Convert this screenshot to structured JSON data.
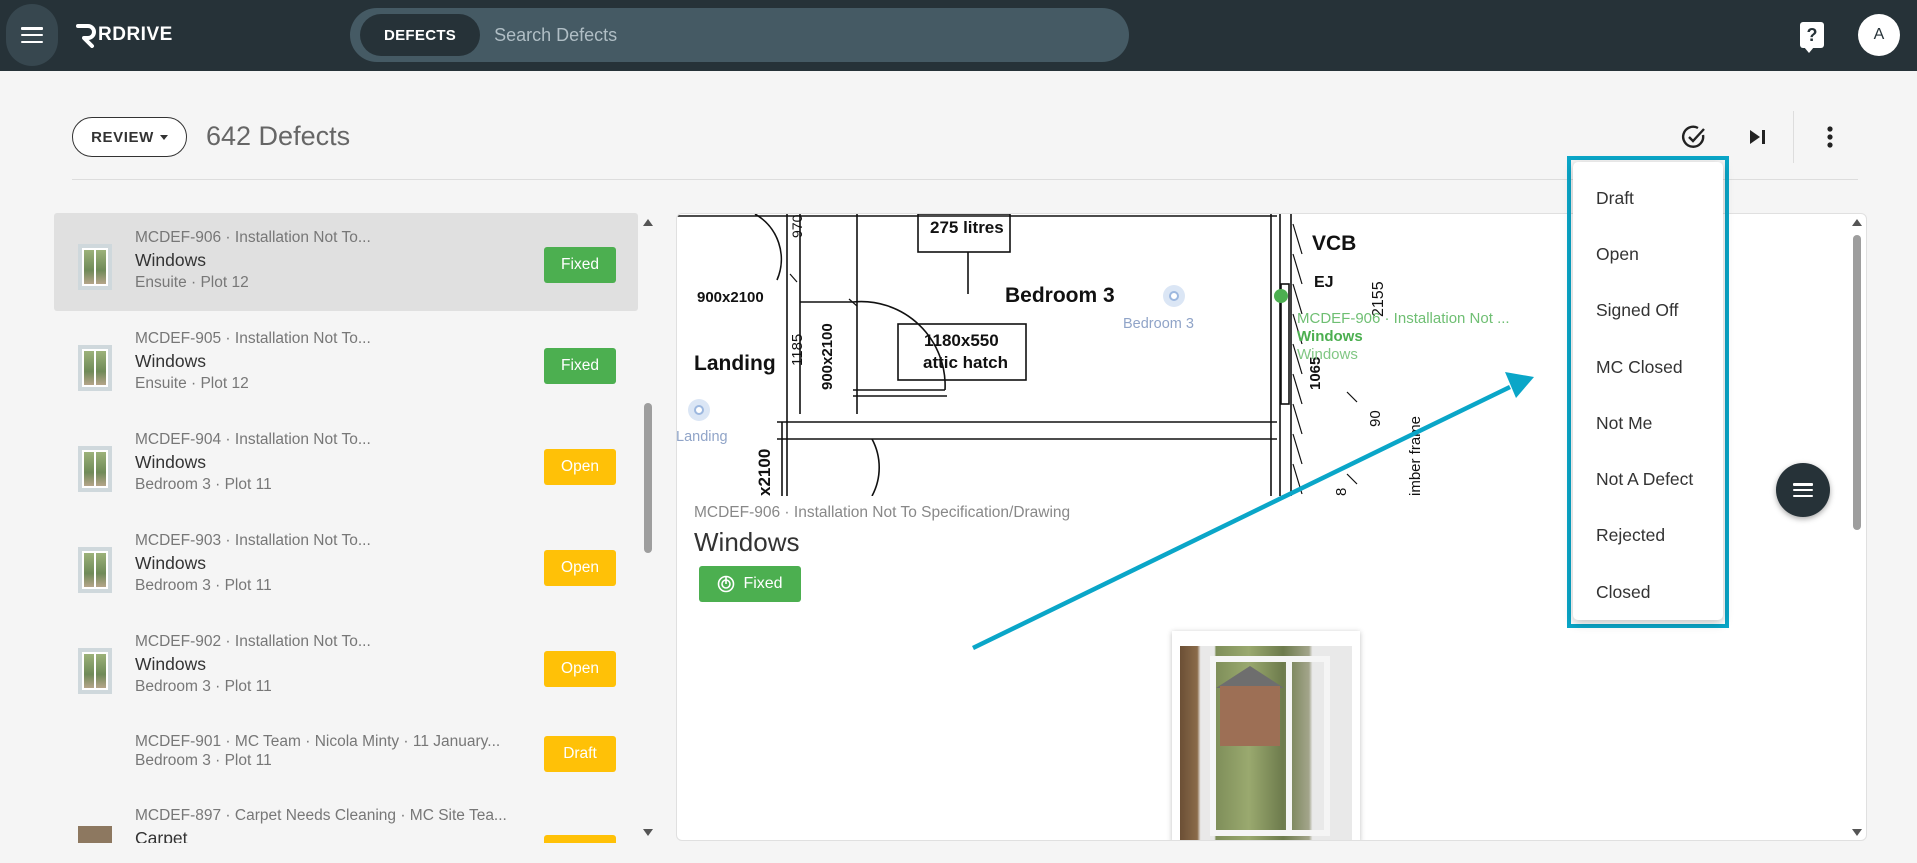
{
  "app": {
    "logo_text": "RDRIVE",
    "search_chip": "DEFECTS",
    "search_placeholder": "Search Defects",
    "help_glyph": "?",
    "avatar_initial": "A"
  },
  "header": {
    "review_label": "REVIEW",
    "defect_count": "642 Defects",
    "icons": [
      "check-circle-icon",
      "skip-next-icon",
      "more-vert-icon"
    ]
  },
  "list": {
    "items": [
      {
        "code": "MCDEF-906 · Installation Not To...",
        "title": "Windows",
        "location": "Ensuite · Plot 12",
        "status": "Fixed",
        "status_color": "#4caf50",
        "selected": true
      },
      {
        "code": "MCDEF-905 · Installation Not To...",
        "title": "Windows",
        "location": "Ensuite · Plot 12",
        "status": "Fixed",
        "status_color": "#4caf50"
      },
      {
        "code": "MCDEF-904 · Installation Not To...",
        "title": "Windows",
        "location": "Bedroom 3 · Plot 11",
        "status": "Open",
        "status_color": "#ffc107"
      },
      {
        "code": "MCDEF-903 · Installation Not To...",
        "title": "Windows",
        "location": "Bedroom 3 · Plot 11",
        "status": "Open",
        "status_color": "#ffc107"
      },
      {
        "code": "MCDEF-902 · Installation Not To...",
        "title": "Windows",
        "location": "Bedroom 3 · Plot 11",
        "status": "Open",
        "status_color": "#ffc107"
      },
      {
        "code": "MCDEF-901 · MC Team · Nicola Minty · 11 January...",
        "title": "",
        "location": "Bedroom 3 · Plot 11",
        "status": "Draft",
        "status_color": "#ffc107"
      },
      {
        "code": "MCDEF-897 · Carpet Needs Cleaning · MC Site Tea...",
        "title": "Carpet",
        "location": "",
        "status": "",
        "status_color": "#ffc107"
      }
    ]
  },
  "detail": {
    "code": "MCDEF-906 · Installation Not To Specification/Drawing",
    "title": "Windows",
    "status": "Fixed",
    "plan": {
      "labels": {
        "litres": "275 litres",
        "bedroom": "Bedroom 3",
        "landing": "Landing",
        "door1": "900x2100",
        "door2": "900x2100",
        "hatch1": "1180x550",
        "hatch2": "attic hatch",
        "vcb": "VCB",
        "ej": "EJ",
        "dim1185": "1185",
        "dim970": "970",
        "dim2155": "2155",
        "dim90": "90",
        "dim8": "8",
        "dimx2100": "x2100",
        "dim1065": "1065",
        "timber": "imber frame"
      },
      "pins": {
        "bedroom_pin": "Bedroom 3",
        "landing_pin": "Landing",
        "active_code": "MCDEF-906 · Installation Not ...",
        "active_title": "Windows",
        "active_sub": "Windows"
      }
    }
  },
  "status_menu": {
    "options": [
      "Draft",
      "Open",
      "Signed Off",
      "MC Closed",
      "Not Me",
      "Not A Defect",
      "Rejected",
      "Closed"
    ],
    "highlight_color": "#0aa6c8"
  }
}
